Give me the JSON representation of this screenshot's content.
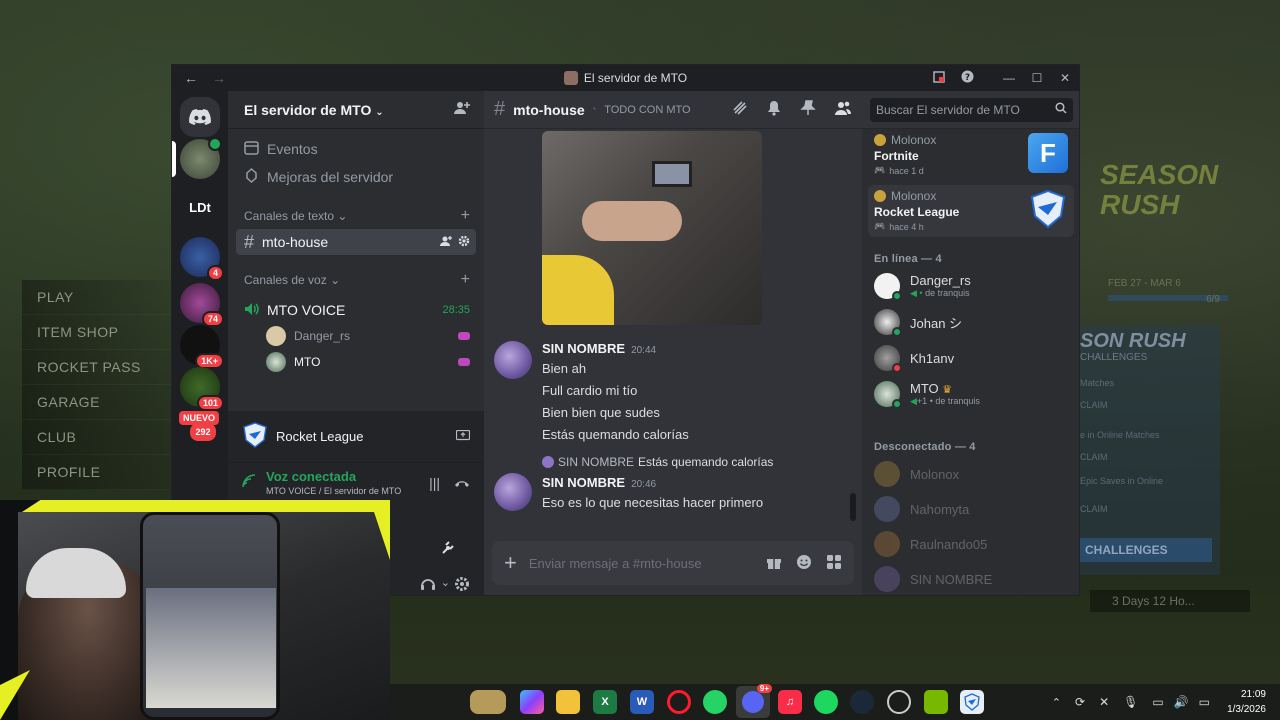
{
  "window": {
    "title": "El servidor de MTO"
  },
  "servers": {
    "items": [
      {
        "label": "LDt"
      },
      {
        "badge": "4"
      },
      {
        "badge": "74"
      },
      {
        "badge": "1K+"
      },
      {
        "badge": "101"
      },
      {
        "badge": "292"
      }
    ],
    "new_label": "NUEVO"
  },
  "sidebar": {
    "server_name": "El servidor de MTO",
    "items": [
      {
        "label": "Eventos",
        "icon": "calendar-icon"
      },
      {
        "label": "Mejoras del servidor",
        "icon": "boost-icon"
      }
    ],
    "text_category": "Canales de texto",
    "text_channels": [
      {
        "name": "mto-house"
      }
    ],
    "voice_category": "Canales de voz",
    "voice_channel": {
      "name": "MTO VOICE",
      "timer": "28:35"
    },
    "voice_users": [
      {
        "name": "Danger_rs",
        "color": "#d9c9a6"
      },
      {
        "name": "MTO",
        "color": "#4a6a55"
      }
    ]
  },
  "activity": {
    "game": "Rocket League"
  },
  "voice": {
    "status": "Voz conectada",
    "location": "MTO VOICE / El servidor de MTO"
  },
  "chat": {
    "channel": "mto-house",
    "topic": "TODO CON MTO",
    "messages": [
      {
        "author": "SIN NOMBRE",
        "time": "20:44",
        "lines": [
          "Bien ah",
          "Full cardio mi tío",
          "Bien bien que sudes",
          "Estás quemando calorías"
        ]
      },
      {
        "reply_author": "SIN NOMBRE",
        "reply_text": "Estás quemando calorías",
        "author": "SIN NOMBRE",
        "time": "20:46",
        "lines": [
          "Eso es lo que necesitas hacer primero"
        ]
      }
    ],
    "composer_placeholder": "Enviar mensaje a #mto-house"
  },
  "members": {
    "search_placeholder": "Buscar El servidor de MTO",
    "activities": [
      {
        "user": "Molonox",
        "game": "Fortnite",
        "time": "hace 1 d"
      },
      {
        "user": "Molonox",
        "game": "Rocket League",
        "time": "hace 4 h"
      }
    ],
    "online_header": "En línea — 4",
    "online": [
      {
        "name": "Danger_rs",
        "sub": "de tranquis",
        "status_color": "#23a55a"
      },
      {
        "name": "Johan シ",
        "sub": "",
        "status_color": "#23a55a"
      },
      {
        "name": "Kh1anv",
        "sub": "",
        "status_color": "#f23f43"
      },
      {
        "name": "MTO",
        "sub": "de tranquis",
        "extra": "+1",
        "status_color": "#23a55a"
      }
    ],
    "offline_header": "Desconectado — 4",
    "offline": [
      {
        "name": "Molonox"
      },
      {
        "name": "Nahomyta"
      },
      {
        "name": "Raulnando05"
      },
      {
        "name": "SIN NOMBRE"
      }
    ]
  },
  "game": {
    "menu": [
      "PLAY",
      "ITEM SHOP",
      "ROCKET PASS",
      "GARAGE",
      "CLUB",
      "PROFILE"
    ],
    "season_title": "SEASON RUSH",
    "season_dates": "FEB 27 - MAR 6",
    "season_count": "6/9",
    "panel_title": "SON RUSH",
    "panel_sub": "CHALLENGES",
    "panel_lines": [
      "Matches",
      "CLAIM",
      "e in Online Matches",
      "CLAIM",
      "Epic Saves in Online",
      "CLAIM"
    ],
    "challenges_button": "CHALLENGES",
    "time_left": "3 Days 12 Ho..."
  },
  "taskbar": {
    "time": "21:09",
    "date": "1/3/2026",
    "discord_badge": "9+"
  },
  "colors": {
    "accent_green": "#23a55a",
    "badge_red": "#f23f43",
    "blurple": "#5865f2",
    "webcam_accent": "#e6ef23"
  }
}
